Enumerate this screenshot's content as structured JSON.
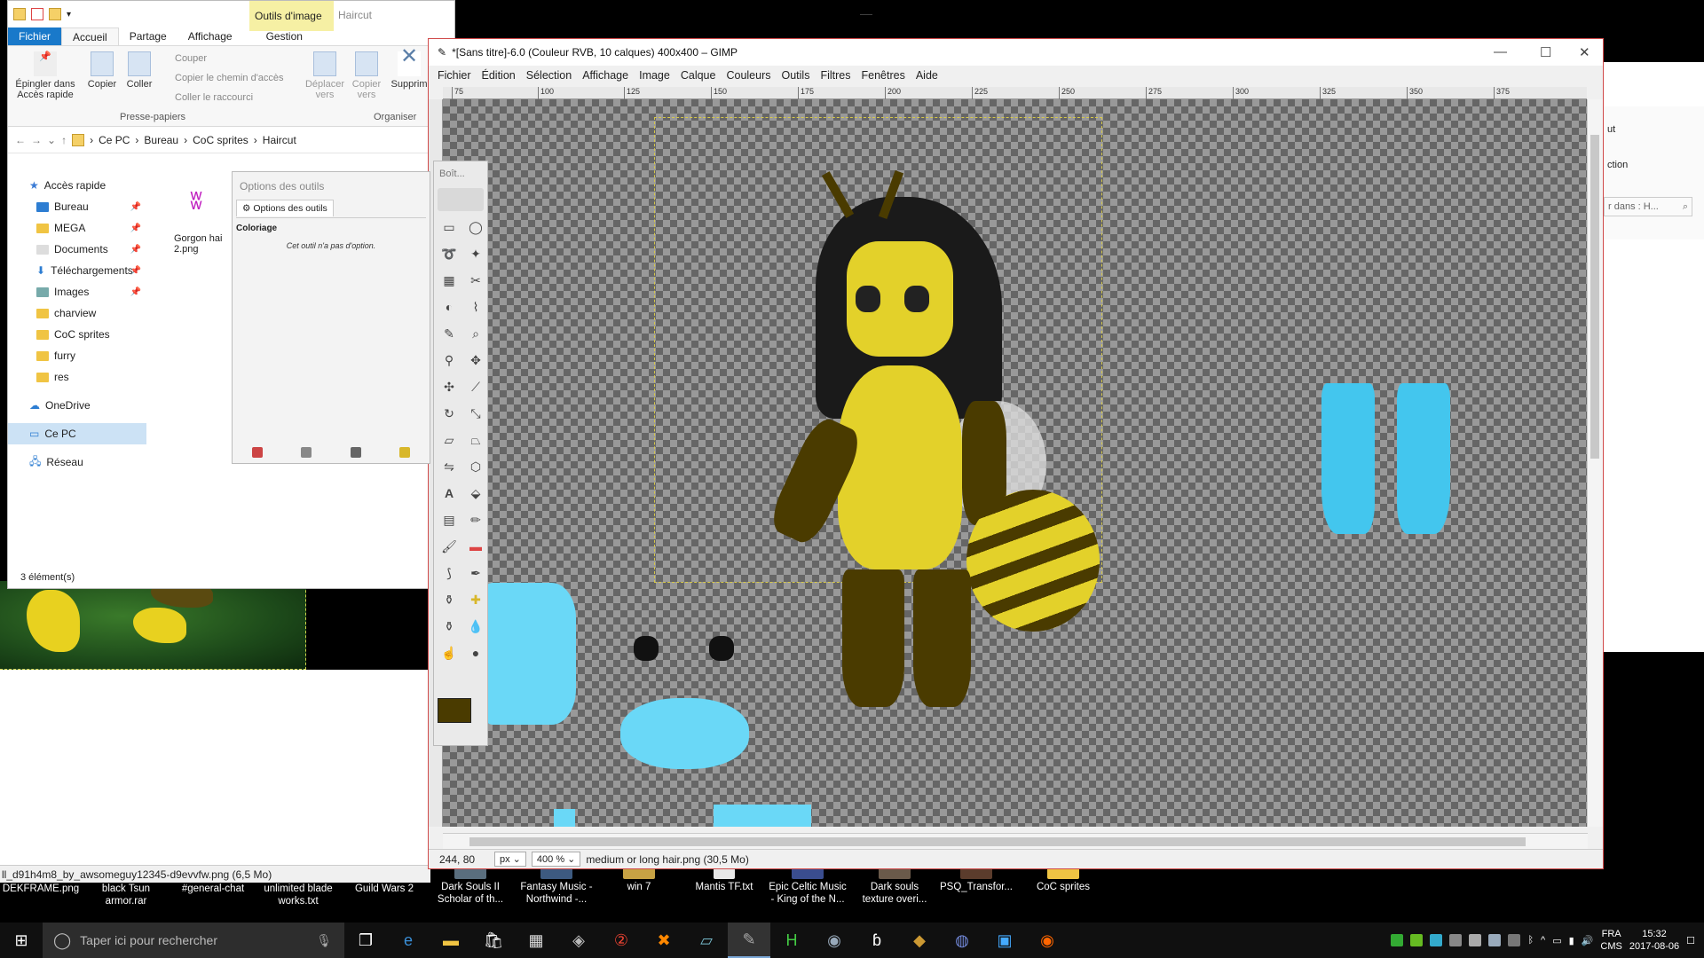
{
  "explorer": {
    "ribbon_tab_context": "Outils d'image",
    "window_title": "Haircut",
    "tabs": [
      "Fichier",
      "Accueil",
      "Partage",
      "Affichage",
      "Gestion"
    ],
    "ribbon": {
      "pin_label": "Épingler dans Accès rapide",
      "copy_label": "Copier",
      "paste_label": "Coller",
      "cut_label": "Couper",
      "copy_path_label": "Copier le chemin d'accès",
      "paste_shortcut_label": "Coller le raccourci",
      "move_label": "Déplacer vers",
      "copy_to_label": "Copier vers",
      "delete_label": "Supprim",
      "group_clipboard": "Presse-papiers",
      "group_organize": "Organiser"
    },
    "breadcrumb": [
      "Ce PC",
      "Bureau",
      "CoC sprites",
      "Haircut"
    ],
    "nav": [
      {
        "label": "Accès rapide",
        "pinned": false
      },
      {
        "label": "Bureau",
        "pinned": true
      },
      {
        "label": "MEGA",
        "pinned": true
      },
      {
        "label": "Documents",
        "pinned": true
      },
      {
        "label": "Téléchargements",
        "pinned": true
      },
      {
        "label": "Images",
        "pinned": true
      },
      {
        "label": "charview",
        "pinned": false
      },
      {
        "label": "CoC sprites",
        "pinned": false
      },
      {
        "label": "furry",
        "pinned": false
      },
      {
        "label": "res",
        "pinned": false
      }
    ],
    "nav_onedrive": "OneDrive",
    "nav_thispc": "Ce PC",
    "nav_network": "Réseau",
    "file_name": "Gorgon hai 2.png",
    "item_count": "3 élément(s)"
  },
  "explorer2": {
    "text1": "ut",
    "text2": "ction",
    "search_placeholder": "r dans : H..."
  },
  "gimp": {
    "title": "*[Sans titre]-6.0 (Couleur RVB, 10 calques) 400x400 – GIMP",
    "menu": [
      "Fichier",
      "Édition",
      "Sélection",
      "Affichage",
      "Image",
      "Calque",
      "Couleurs",
      "Outils",
      "Filtres",
      "Fenêtres",
      "Aide"
    ],
    "ruler_ticks": [
      "75",
      "100",
      "125",
      "150",
      "175",
      "200",
      "225",
      "250",
      "275",
      "300",
      "325",
      "350",
      "375"
    ],
    "status": {
      "coords": "244, 80",
      "unit": "px",
      "zoom": "400 %",
      "layer_info": "medium or long hair.png (30,5 Mo)"
    }
  },
  "tool_options": {
    "header": "Options des outils",
    "tab": "Options des outils",
    "section": "Coloriage",
    "message": "Cet outil n'a pas d'option."
  },
  "toolbox": {
    "header": "Boît...",
    "fg_color": "#4a3b00"
  },
  "desktop": {
    "path_status": "ll_d91h4m8_by_awsomeguy12345-d9evvfw.png (6,5 Mo)",
    "icons": [
      {
        "label": "DEKFRAME.png"
      },
      {
        "label": "black Tsun armor.rar"
      },
      {
        "label": "#general-chat"
      },
      {
        "label": "unlimited blade works.txt"
      },
      {
        "label": "Guild Wars 2"
      },
      {
        "label": "Dark Souls II Scholar of th..."
      },
      {
        "label": "Fantasy Music - Northwind -..."
      },
      {
        "label": "win 7"
      },
      {
        "label": "Mantis TF.txt"
      },
      {
        "label": "Epic Celtic Music - King of the N..."
      },
      {
        "label": "Dark souls texture overi..."
      },
      {
        "label": "PSQ_Transfor..."
      },
      {
        "label": "CoC sprites"
      }
    ]
  },
  "taskbar": {
    "search_placeholder": "Taper ici pour rechercher",
    "lang1": "FRA",
    "lang2": "CMS",
    "time": "15:32",
    "date": "2017-08-06"
  }
}
